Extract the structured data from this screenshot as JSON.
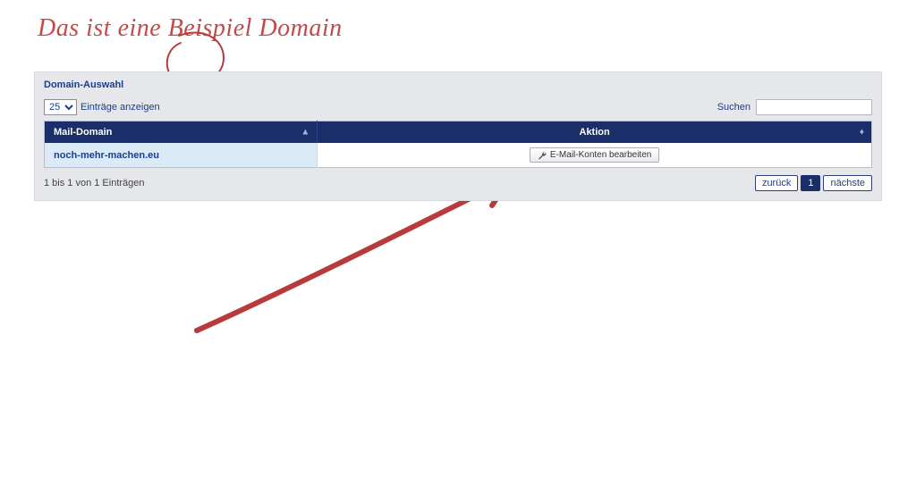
{
  "annotation": "Das ist eine Beispiel Domain",
  "panel": {
    "title": "Domain-Auswahl",
    "length_value": "25",
    "length_label": "Einträge anzeigen",
    "search_label": "Suchen",
    "search_value": "",
    "columns": {
      "mail_domain": "Mail-Domain",
      "action": "Aktion"
    },
    "rows": [
      {
        "domain": "noch-mehr-machen.eu",
        "action_label": "E-Mail-Konten bearbeiten"
      }
    ],
    "info": "1 bis 1 von 1 Einträgen",
    "pager": {
      "prev": "zurück",
      "page1": "1",
      "next": "nächste"
    }
  }
}
